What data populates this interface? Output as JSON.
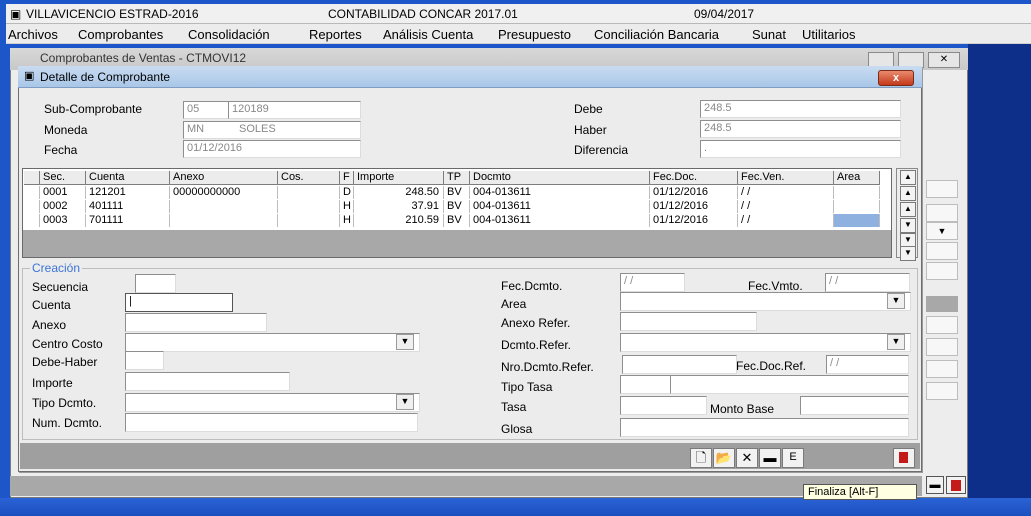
{
  "app": {
    "company": "VILLAVICENCIO ESTRAD-2016",
    "system": "CONTABILIDAD CONCAR 2017.01",
    "date": "09/04/2017"
  },
  "menu": [
    "Archivos",
    "Comprobantes",
    "Consolidación",
    "Reportes",
    "Análisis Cuenta",
    "Presupuesto",
    "Conciliación Bancaria",
    "Sunat",
    "Utilitarios"
  ],
  "back_window": {
    "title": "Comprobantes de Ventas - CTMOVI12"
  },
  "dialog": {
    "title": "Detalle de Comprobante",
    "close": "x",
    "header": {
      "subcomp_label": "Sub-Comprobante",
      "subcomp_code": "05",
      "subcomp_number": "120189",
      "moneda_label": "Moneda",
      "moneda_code": "MN",
      "moneda_name": "SOLES",
      "fecha_label": "Fecha",
      "fecha_value": "01/12/2016",
      "debe_label": "Debe",
      "debe_value": "248.5",
      "haber_label": "Haber",
      "haber_value": "248.5",
      "diferencia_label": "Diferencia",
      "diferencia_value": "."
    },
    "grid": {
      "columns": [
        "Sec.",
        "Cuenta",
        "Anexo",
        "Cos.",
        "F",
        "Importe",
        "TP",
        "Docmto",
        "Fec.Doc.",
        "Fec.Ven.",
        "Area"
      ],
      "rows": [
        [
          "0001",
          "121201",
          "00000000000",
          "",
          "D",
          "248.50",
          "BV",
          "004-013611",
          "01/12/2016",
          "/ /",
          ""
        ],
        [
          "0002",
          "401111",
          "",
          "",
          "H",
          "37.91",
          "BV",
          "004-013611",
          "01/12/2016",
          "/ /",
          ""
        ],
        [
          "0003",
          "701111",
          "",
          "",
          "H",
          "210.59",
          "BV",
          "004-013611",
          "01/12/2016",
          "/ /",
          ""
        ]
      ]
    },
    "creacion": {
      "group_label": "Creación",
      "secuencia_label": "Secuencia",
      "cuenta_label": "Cuenta",
      "anexo_label": "Anexo",
      "centro_costo_label": "Centro Costo",
      "debe_haber_label": "Debe-Haber",
      "importe_label": "Importe",
      "tipo_dcmto_label": "Tipo Dcmto.",
      "num_dcmto_label": "Num. Dcmto.",
      "fec_dcmto_label": "Fec.Dcmto.",
      "fec_dcmto_value": "/ /",
      "fec_vmto_label": "Fec.Vmto.",
      "fec_vmto_value": "/ /",
      "area_label": "Area",
      "anexo_refer_label": "Anexo Refer.",
      "dcmto_refer_label": "Dcmto.Refer.",
      "nro_dcmto_refer_label": "Nro.Dcmto.Refer.",
      "fec_doc_ref_label": "Fec.Doc.Ref.",
      "fec_doc_ref_value": "/ /",
      "tipo_tasa_label": "Tipo Tasa",
      "tasa_label": "Tasa",
      "monto_base_label": "Monto Base",
      "glosa_label": "Glosa"
    },
    "toolbar": {
      "edit_label": "E"
    }
  },
  "tooltip": "Finaliza  [Alt-F]"
}
